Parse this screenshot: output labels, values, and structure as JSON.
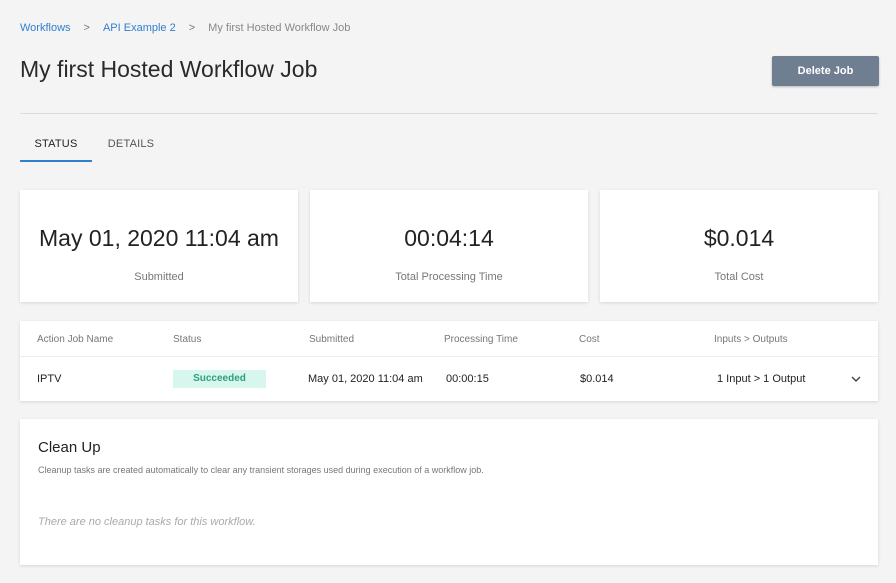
{
  "breadcrumb": {
    "items": [
      "Workflows",
      "API Example 2"
    ],
    "current": "My first Hosted Workflow Job",
    "separator": ">"
  },
  "header": {
    "title": "My first Hosted Workflow Job",
    "delete_label": "Delete Job"
  },
  "tabs": [
    {
      "label": "STATUS",
      "active": true
    },
    {
      "label": "DETAILS",
      "active": false
    }
  ],
  "stats": [
    {
      "value": "May 01, 2020 11:04 am",
      "label": "Submitted"
    },
    {
      "value": "00:04:14",
      "label": "Total Processing Time"
    },
    {
      "value": "$0.014",
      "label": "Total Cost"
    }
  ],
  "jobs_table": {
    "columns": [
      "Action Job Name",
      "Status",
      "Submitted",
      "Processing Time",
      "Cost",
      "Inputs > Outputs"
    ],
    "rows": [
      {
        "name": "IPTV",
        "status": "Succeeded",
        "submitted": "May 01, 2020 11:04 am",
        "processing_time": "00:00:15",
        "cost": "$0.014",
        "io": "1 Input > 1 Output",
        "expand_icon": "chevron-down-icon"
      }
    ]
  },
  "cleanup": {
    "title": "Clean Up",
    "description": "Cleanup tasks are created automatically to clear any transient storages used during execution of a workflow job.",
    "empty_message": "There are no cleanup tasks for this workflow."
  },
  "colors": {
    "accent": "#2f7fd0",
    "delete_button": "#6f7f91",
    "success_bg": "#d7f6ed",
    "success_text": "#2ea07a",
    "page_bg": "#f4f4f4"
  }
}
